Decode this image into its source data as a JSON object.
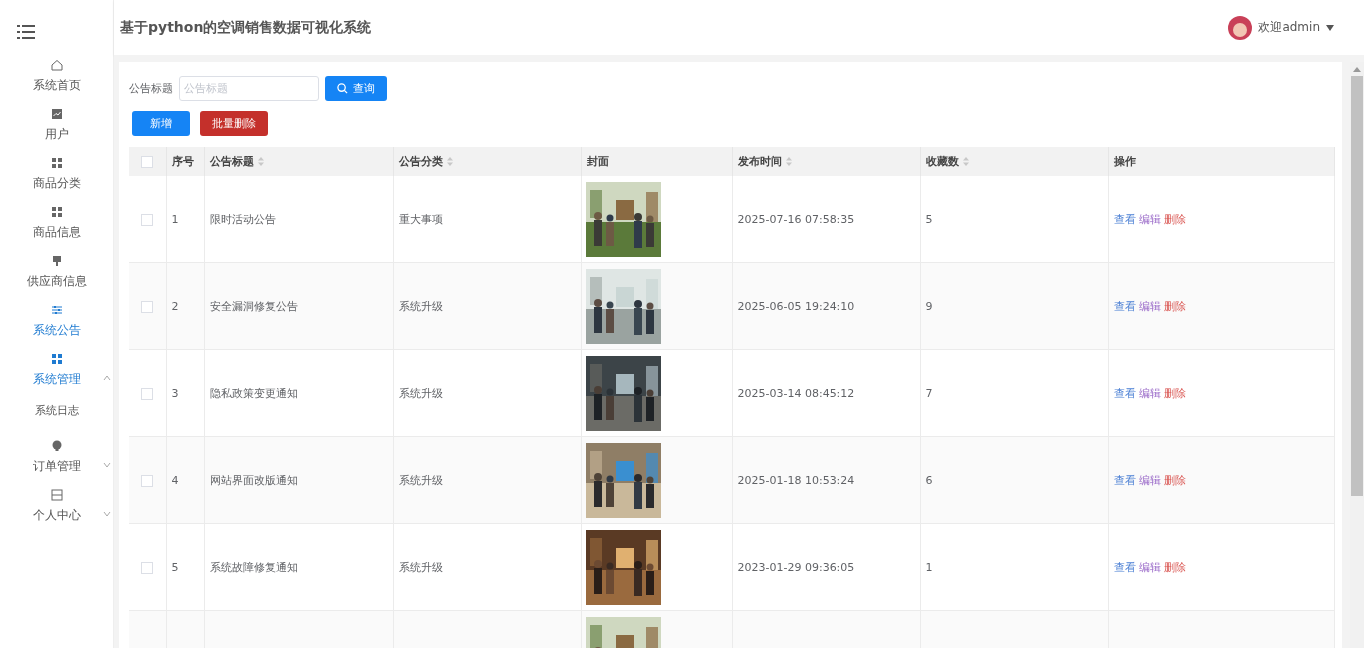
{
  "header": {
    "title": "基于python的空调销售数据可视化系统",
    "user": "欢迎admin"
  },
  "sidebar": {
    "items": [
      {
        "label": "系统首页",
        "selected": false
      },
      {
        "label": "用户",
        "selected": false
      },
      {
        "label": "商品分类",
        "selected": false
      },
      {
        "label": "商品信息",
        "selected": false
      },
      {
        "label": "供应商信息",
        "selected": false
      },
      {
        "label": "系统公告",
        "selected": true
      },
      {
        "label": "系统管理",
        "expanded": true,
        "children": [
          {
            "label": "系统日志",
            "selected": false
          }
        ]
      },
      {
        "label": "订单管理",
        "expanded": false
      },
      {
        "label": "个人中心",
        "expanded": false
      }
    ]
  },
  "search": {
    "label": "公告标题",
    "placeholder": "公告标题",
    "button": "查询"
  },
  "actions": [
    {
      "label": "新增",
      "kind": "primary"
    },
    {
      "label": "批量删除",
      "kind": "danger"
    }
  ],
  "table": {
    "select_all": {
      "checked": false
    },
    "columns": [
      {
        "label": "序号",
        "sortable": false
      },
      {
        "label": "公告标题",
        "sortable": true
      },
      {
        "label": "公告分类",
        "sortable": true
      },
      {
        "label": "封面",
        "sortable": false
      },
      {
        "label": "发布时间",
        "sortable": true
      },
      {
        "label": "收藏数",
        "sortable": true
      },
      {
        "label": "操作",
        "sortable": false
      }
    ],
    "rows": [
      {
        "checked": false,
        "no": "1",
        "title": "限时活动公告",
        "category": "重大事项",
        "cover": {
          "kind": "picture"
        },
        "time": "2025-07-16 07:58:35",
        "favorites": "5",
        "ops": [
          "查看",
          "编辑",
          "删除"
        ]
      },
      {
        "checked": false,
        "no": "2",
        "title": "安全漏洞修复公告",
        "category": "系统升级",
        "cover": {
          "kind": "picture"
        },
        "time": "2025-06-05 19:24:10",
        "favorites": "9",
        "ops": [
          "查看",
          "编辑",
          "删除"
        ]
      },
      {
        "checked": false,
        "no": "3",
        "title": "隐私政策变更通知",
        "category": "系统升级",
        "cover": {
          "kind": "picture"
        },
        "time": "2025-03-14 08:45:12",
        "favorites": "7",
        "ops": [
          "查看",
          "编辑",
          "删除"
        ]
      },
      {
        "checked": false,
        "no": "4",
        "title": "网站界面改版通知",
        "category": "系统升级",
        "cover": {
          "kind": "picture"
        },
        "time": "2025-01-18 10:53:24",
        "favorites": "6",
        "ops": [
          "查看",
          "编辑",
          "删除"
        ]
      },
      {
        "checked": false,
        "no": "5",
        "title": "系统故障修复通知",
        "category": "系统升级",
        "cover": {
          "kind": "picture"
        },
        "time": "2023-01-29 09:36:05",
        "favorites": "1",
        "ops": [
          "查看",
          "编辑",
          "删除"
        ]
      },
      {
        "cover": {
          "kind": "picture"
        }
      }
    ]
  }
}
